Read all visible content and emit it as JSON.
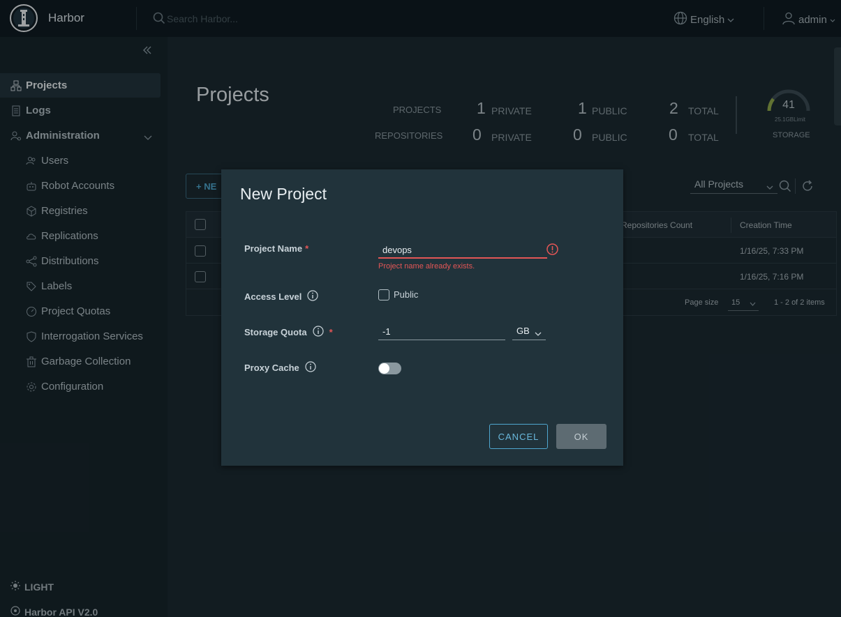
{
  "header": {
    "brand": "Harbor",
    "search_placeholder": "Search Harbor...",
    "language": "English",
    "user": "admin"
  },
  "sidebar": {
    "items": [
      {
        "label": "Projects",
        "icon": "projects-icon"
      },
      {
        "label": "Logs",
        "icon": "logs-icon"
      },
      {
        "label": "Administration",
        "icon": "administration-icon"
      },
      {
        "label": "Users",
        "icon": "users-icon"
      },
      {
        "label": "Robot Accounts",
        "icon": "robot-icon"
      },
      {
        "label": "Registries",
        "icon": "registries-icon"
      },
      {
        "label": "Replications",
        "icon": "replications-icon"
      },
      {
        "label": "Distributions",
        "icon": "distributions-icon"
      },
      {
        "label": "Labels",
        "icon": "labels-icon"
      },
      {
        "label": "Project Quotas",
        "icon": "quotas-icon"
      },
      {
        "label": "Interrogation Services",
        "icon": "interrogation-icon"
      },
      {
        "label": "Garbage Collection",
        "icon": "trash-icon"
      },
      {
        "label": "Configuration",
        "icon": "gear-icon"
      }
    ],
    "theme_toggle": "LIGHT",
    "api_link": "Harbor API V2.0"
  },
  "main": {
    "title": "Projects",
    "stats": {
      "projects_label": "PROJECTS",
      "repositories_label": "REPOSITORIES",
      "private_label": "PRIVATE",
      "public_label": "PUBLIC",
      "total_label": "TOTAL",
      "projects_private": "1",
      "projects_public": "1",
      "projects_total": "2",
      "repos_private": "0",
      "repos_public": "0",
      "repos_total": "0"
    },
    "storage": {
      "value": "41",
      "limit": "25.1GBLimit",
      "label": "STORAGE"
    },
    "new_button": "+ NE",
    "filter": "All Projects",
    "table": {
      "columns": [
        "Repositories Count",
        "Creation Time"
      ],
      "rows": [
        {
          "created": "1/16/25, 7:33 PM"
        },
        {
          "created": "1/16/25, 7:16 PM"
        }
      ],
      "page_size_label": "Page size",
      "page_size": "15",
      "range": "1 - 2 of 2 items"
    }
  },
  "modal": {
    "title": "New Project",
    "project_name_label": "Project Name",
    "required_mark": "*",
    "project_name_value": "devops",
    "error": "Project name already exists.",
    "access_level_label": "Access Level",
    "public_label": "Public",
    "storage_quota_label": "Storage Quota",
    "storage_quota_value": "-1",
    "storage_unit": "GB",
    "proxy_cache_label": "Proxy Cache",
    "cancel": "CANCEL",
    "ok": "OK"
  },
  "colors": {
    "accent": "#4fa7cf",
    "error": "#e35656",
    "background": "#1b2a32",
    "modal": "#21333b"
  }
}
